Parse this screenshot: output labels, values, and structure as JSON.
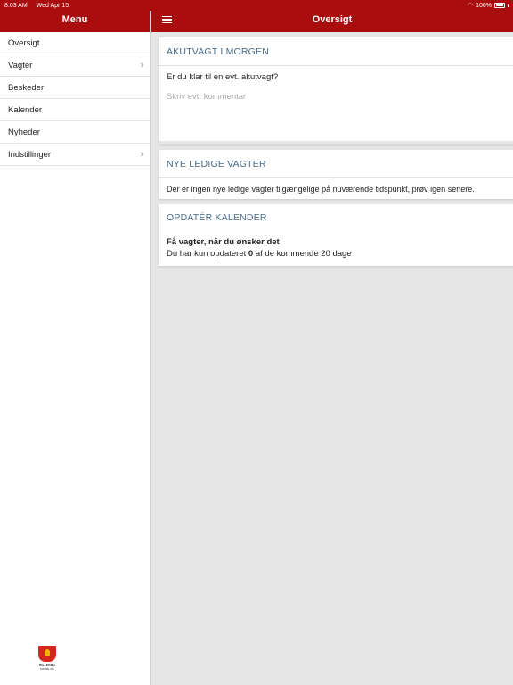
{
  "status_bar": {
    "time": "8:03 AM",
    "date": "Wed Apr 15",
    "battery": "100%"
  },
  "sidebar": {
    "title": "Menu",
    "items": [
      {
        "label": "Oversigt",
        "has_chevron": false
      },
      {
        "label": "Vagter",
        "has_chevron": true
      },
      {
        "label": "Beskeder",
        "has_chevron": false
      },
      {
        "label": "Kalender",
        "has_chevron": false
      },
      {
        "label": "Nyheder",
        "has_chevron": false
      },
      {
        "label": "Indstillinger",
        "has_chevron": true
      }
    ],
    "chevron_icon": "chevron-right-icon",
    "logo_line1": "HILLERØD",
    "logo_line2": "KOMMUNE"
  },
  "header": {
    "title": "Oversigt",
    "menu_icon": "hamburger-icon"
  },
  "cards": {
    "akutvagt": {
      "title": "AKUTVAGT I MORGEN",
      "question": "Er du klar til en evt. akutvagt?",
      "comment_placeholder": "Skriv evt. kommentar"
    },
    "ledige": {
      "title": "NYE LEDIGE VAGTER",
      "message": "Der er ingen nye ledige vagter tilgængelige på nuværende tidspunkt, prøv igen senere."
    },
    "kalender": {
      "title": "OPDATÉR KALENDER",
      "headline": "Få vagter, når du ønsker det",
      "text_prefix": "Du har kun opdateret",
      "updated_count": "0",
      "text_suffix": "af de kommende 20 dage"
    }
  },
  "colors": {
    "brand": "#a90d0d",
    "card_title": "#4a6b8a",
    "background": "#e6e6e6"
  }
}
